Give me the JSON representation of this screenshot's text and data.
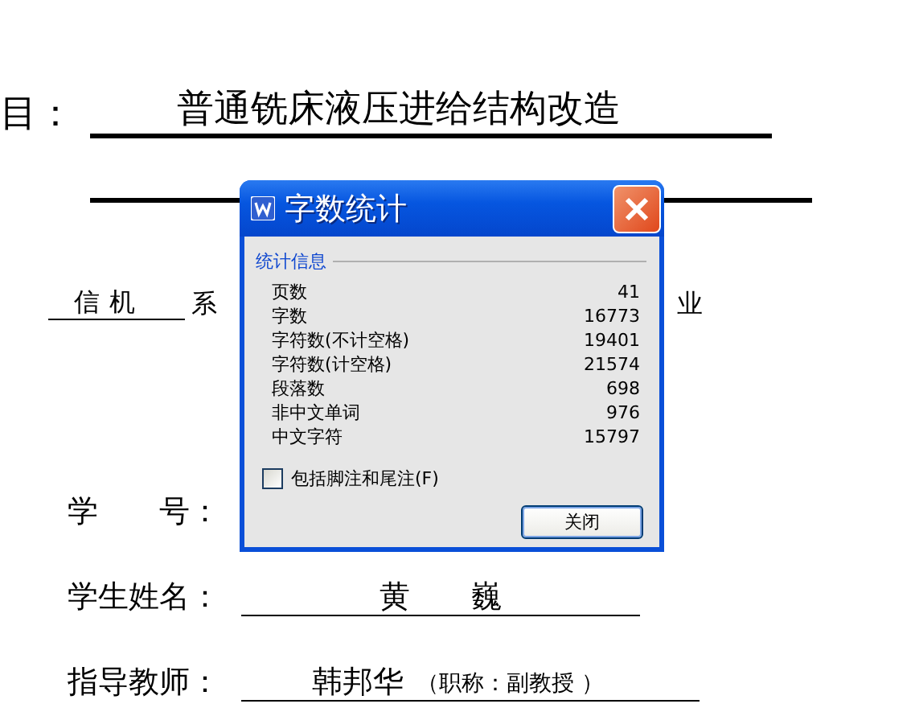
{
  "document": {
    "title_label": "目：",
    "title_value": "普通铣床液压进给结构改造",
    "department_value": "信机",
    "department_label": "系",
    "major_tail": "业",
    "fields": [
      {
        "label": "学　　号："
      },
      {
        "label": "学生姓名：",
        "value": "黄　　巍"
      },
      {
        "label": "指导教师：",
        "value": "韩邦华",
        "note": "（职称：副教授 ）"
      }
    ]
  },
  "dialog": {
    "title": "字数统计",
    "group": "统计信息",
    "stats": [
      {
        "label": "页数",
        "value": "41"
      },
      {
        "label": "字数",
        "value": "16773"
      },
      {
        "label": "字符数(不计空格)",
        "value": "19401"
      },
      {
        "label": "字符数(计空格)",
        "value": "21574"
      },
      {
        "label": "段落数",
        "value": "698"
      },
      {
        "label": "非中文单词",
        "value": "976"
      },
      {
        "label": "中文字符",
        "value": "15797"
      }
    ],
    "include_notes": {
      "label": "包括脚注和尾注(F)",
      "checked": false
    },
    "close_button": "关闭"
  }
}
